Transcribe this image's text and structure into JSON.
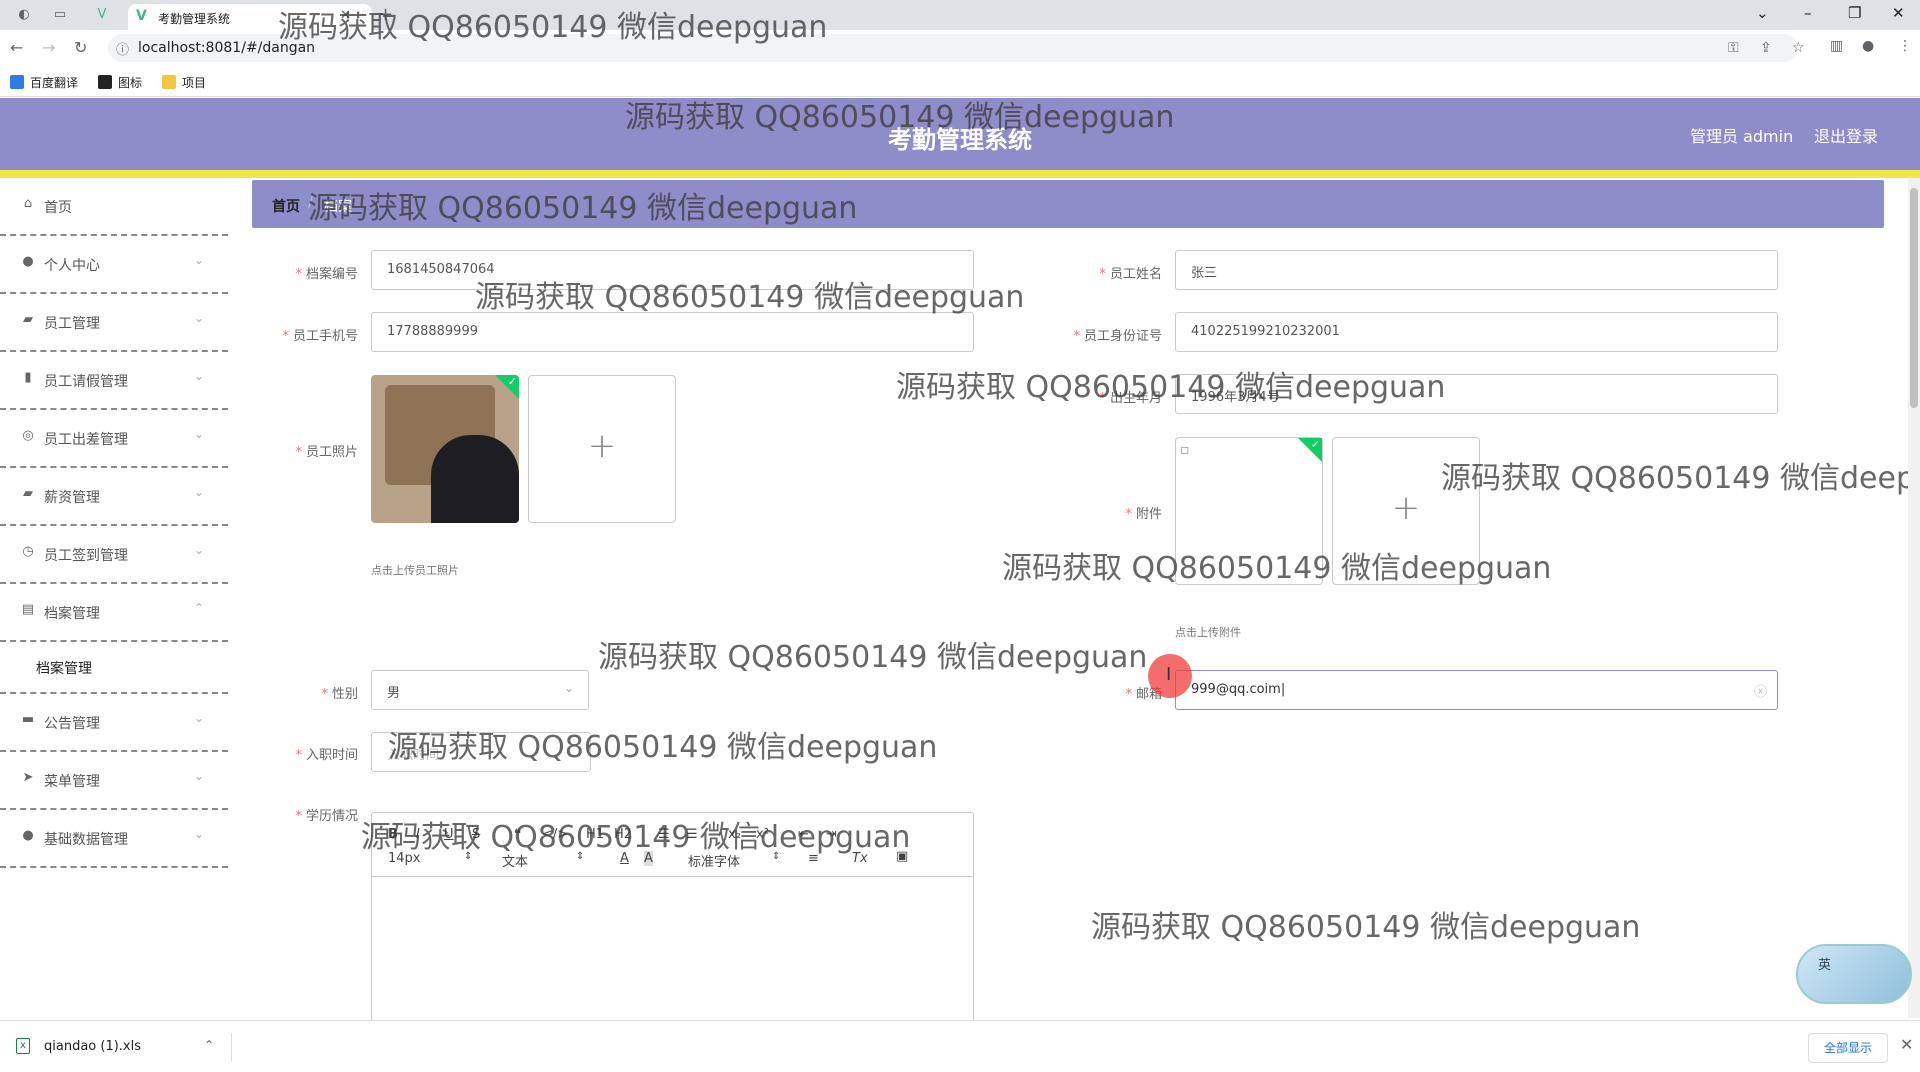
{
  "browser": {
    "tab_title": "考勤管理系统",
    "url": "localhost:8081/#/dangan",
    "bookmarks": [
      "百度翻译",
      "图标",
      "项目"
    ]
  },
  "header": {
    "title": "考勤管理系统",
    "user": "管理员 admin",
    "logout": "退出登录"
  },
  "sidebar": {
    "items": [
      {
        "label": "首页",
        "icon": "home-icon"
      },
      {
        "label": "个人中心",
        "icon": "user-icon"
      },
      {
        "label": "员工管理",
        "icon": "briefcase-icon"
      },
      {
        "label": "员工请假管理",
        "icon": "bar-chart-icon"
      },
      {
        "label": "员工出差管理",
        "icon": "compass-icon"
      },
      {
        "label": "薪资管理",
        "icon": "briefcase-icon"
      },
      {
        "label": "员工签到管理",
        "icon": "clock-icon"
      },
      {
        "label": "档案管理",
        "icon": "clipboard-icon"
      },
      {
        "label": "档案管理",
        "icon": ""
      },
      {
        "label": "公告管理",
        "icon": "monitor-icon"
      },
      {
        "label": "菜单管理",
        "icon": "send-icon"
      },
      {
        "label": "基础数据管理",
        "icon": "user-icon"
      }
    ]
  },
  "breadcrumb": {
    "home": "首页",
    "current": "档案"
  },
  "form": {
    "archive_no": {
      "label": "档案编号",
      "value": "1681450847064"
    },
    "name": {
      "label": "员工姓名",
      "value": "张三"
    },
    "phone": {
      "label": "员工手机号",
      "value": "17788889999"
    },
    "id_card": {
      "label": "员工身份证号",
      "value": "410225199210232001"
    },
    "birth": {
      "label": "出生年月",
      "value": "1996年3月4号"
    },
    "photo": {
      "label": "员工照片",
      "hint": "点击上传员工照片"
    },
    "attachment": {
      "label": "附件",
      "hint": "点击上传附件"
    },
    "gender": {
      "label": "性别",
      "value": "男"
    },
    "email": {
      "label": "邮箱",
      "value": "999@qq.coim|"
    },
    "hire_date": {
      "label": "入职时间",
      "placeholder": "入职时间"
    },
    "education": {
      "label": "学历情况"
    }
  },
  "editor": {
    "font_size": "14px",
    "block": "文本",
    "font": "标准字体",
    "toolbar_row1": [
      "B",
      "I",
      "U",
      "S",
      "❝",
      "</>",
      "H1",
      "H2",
      "☰",
      "☰",
      "x₂",
      "x²",
      "⇤",
      "⇥"
    ],
    "toolbar_row2": [
      "A",
      "A",
      "≡",
      "Tx",
      "▣"
    ]
  },
  "watermark": "源码获取 QQ86050149 微信deepguan",
  "download": {
    "file": "qiandao (1).xls",
    "show_all": "全部显示"
  },
  "ime": {
    "label": "英"
  },
  "colors": {
    "header": "#8c8dc9",
    "accent_bar": "#f0e84a",
    "required": "#f56c6c",
    "success": "#13ce66"
  }
}
